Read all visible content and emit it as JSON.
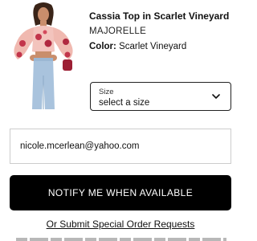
{
  "product": {
    "title": "Cassia Top in Scarlet Vineyard",
    "brand": "MAJORELLE",
    "color_label": "Color:",
    "color_value": "Scarlet Vineyard"
  },
  "size_select": {
    "label": "Size",
    "value": "select a size",
    "icon": "chevron-down-icon"
  },
  "email": {
    "value": "nicole.mcerlean@yahoo.com"
  },
  "notify_button": {
    "label": "NOTIFY ME WHEN AVAILABLE"
  },
  "special_order_link": {
    "label": "Or Submit Special Order Requests"
  },
  "colors": {
    "button_background": "#000000",
    "button_text": "#ffffff",
    "field_border": "#cccccc",
    "select_border": "#222222"
  }
}
